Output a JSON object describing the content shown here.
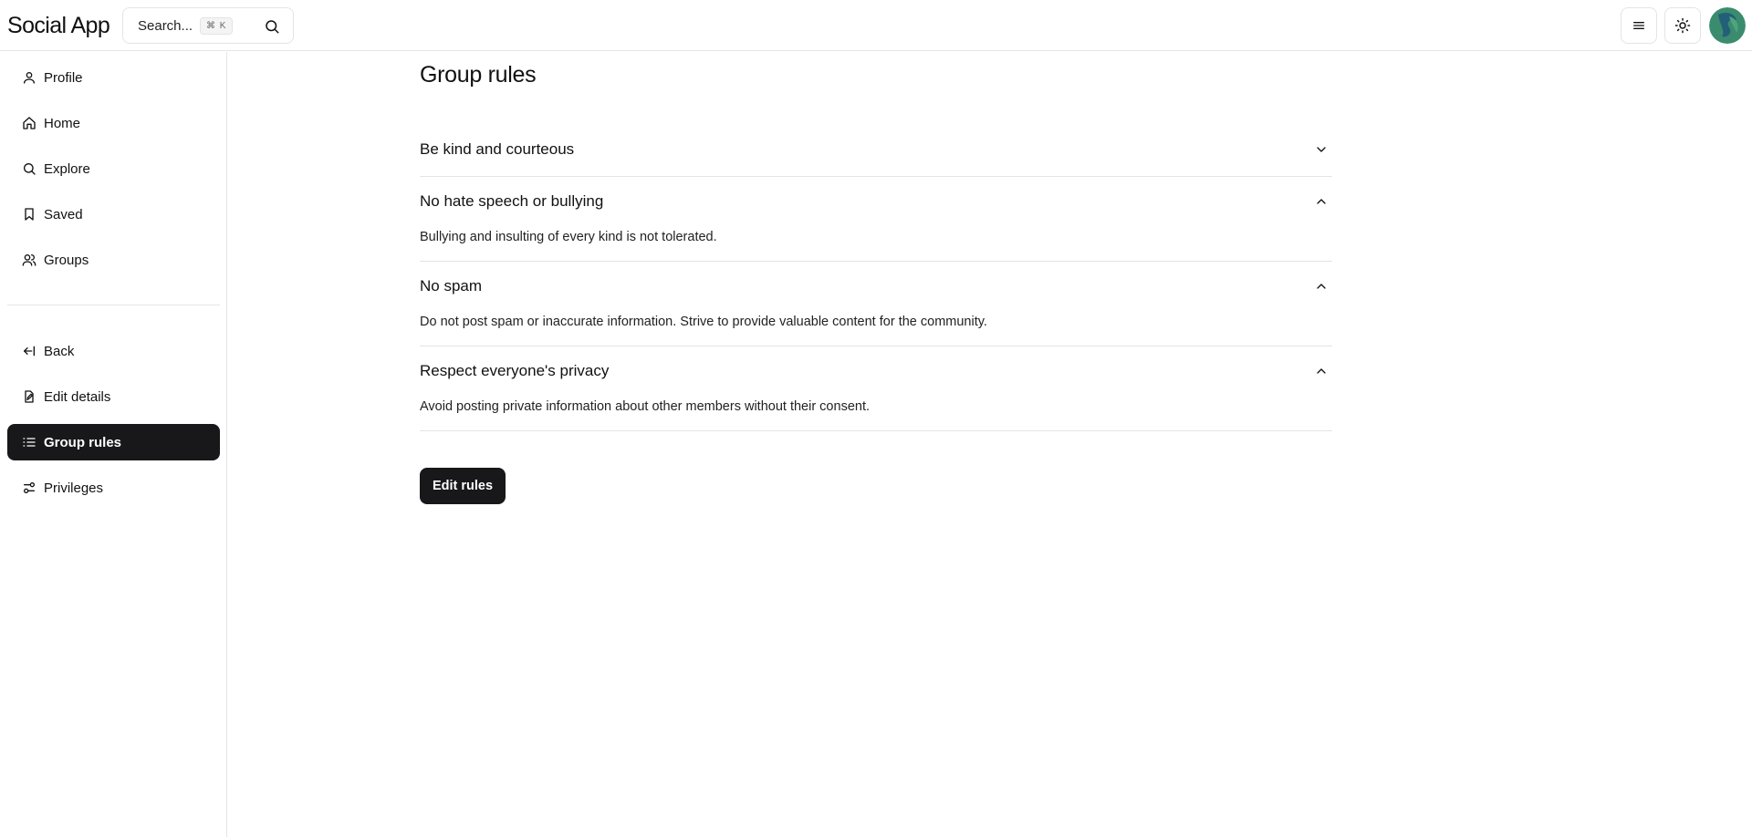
{
  "header": {
    "app_title": "Social App",
    "search_placeholder": "Search...",
    "search_shortcut": "⌘ K"
  },
  "sidebar": {
    "items": [
      {
        "label": "Profile",
        "icon": "user-icon"
      },
      {
        "label": "Home",
        "icon": "home-icon"
      },
      {
        "label": "Explore",
        "icon": "search-icon"
      },
      {
        "label": "Saved",
        "icon": "bookmark-icon"
      },
      {
        "label": "Groups",
        "icon": "users-icon"
      }
    ],
    "group_items": [
      {
        "label": "Back",
        "icon": "back-arrow-icon"
      },
      {
        "label": "Edit details",
        "icon": "edit-file-icon"
      },
      {
        "label": "Group rules",
        "icon": "list-icon",
        "active": true
      },
      {
        "label": "Privileges",
        "icon": "sliders-icon"
      }
    ]
  },
  "main": {
    "title": "Group rules",
    "rules": [
      {
        "title": "Be kind and courteous",
        "expanded": false,
        "body": ""
      },
      {
        "title": "No hate speech or bullying",
        "expanded": true,
        "body": "Bullying and insulting of every kind is not tolerated."
      },
      {
        "title": "No spam",
        "expanded": true,
        "body": "Do not post spam or inaccurate information. Strive to provide valuable content for the community."
      },
      {
        "title": "Respect everyone's privacy",
        "expanded": true,
        "body": "Avoid posting private information about other members without their consent."
      }
    ],
    "edit_button_label": "Edit rules"
  },
  "colors": {
    "active_bg": "#18181b",
    "border": "#e4e4e4"
  }
}
